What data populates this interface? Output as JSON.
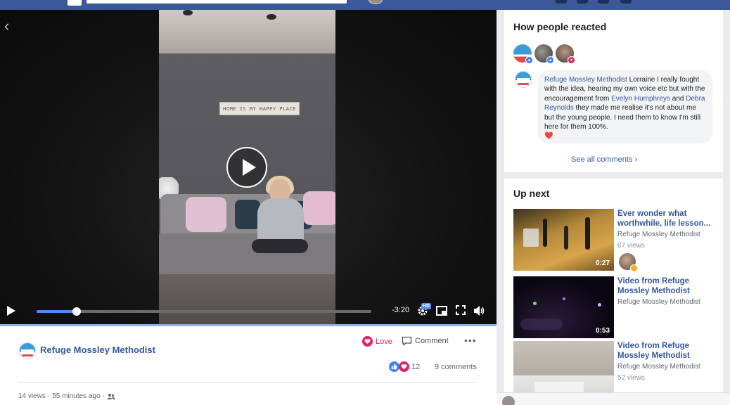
{
  "video": {
    "wall_sign": "HOME IS MY HAPPY PLACE",
    "time_remaining": "-3:20",
    "hd_label": "HD",
    "progress": 0.12
  },
  "post": {
    "page_name": "Refuge Mossley Methodist",
    "love_label": "Love",
    "comment_label": "Comment",
    "reaction_count": "12",
    "comments_label": "9 comments",
    "views": "14 views",
    "separator": "·",
    "time_ago": "55 minutes ago",
    "separator2": "·"
  },
  "reactions_card": {
    "title": "How people reacted",
    "comment": {
      "author": "Refuge Mossley Methodist",
      "text_1": " Lorraine I really fought with the idea, hearing my own voice etc but with the encouragement from ",
      "link_1": "Evelyn Humphreys",
      "text_2": " and ",
      "link_2": "Debra Reynolds",
      "text_3": " they made me realise it's not about me but the young people. I need them to know I'm still here for them 100%.",
      "emoji": "❤️"
    },
    "see_all": "See all comments"
  },
  "up_next": {
    "title": "Up next",
    "items": [
      {
        "title": "Ever wonder what worthwhile, life lesson...",
        "page": "Refuge Mossley Methodist",
        "views": "67 views",
        "duration": "0:27"
      },
      {
        "title": "Video from Refuge Mossley Methodist",
        "page": "Refuge Mossley Methodist",
        "views": "",
        "duration": "0:53"
      },
      {
        "title": "Video from Refuge Mossley Methodist",
        "page": "Refuge Mossley Methodist",
        "views": "52 views",
        "duration": ""
      }
    ]
  },
  "colors": {
    "brand_blue": "#3b5998",
    "link_blue": "#365899",
    "progress_blue": "#4a8cf7",
    "love_red": "#e0245e"
  }
}
